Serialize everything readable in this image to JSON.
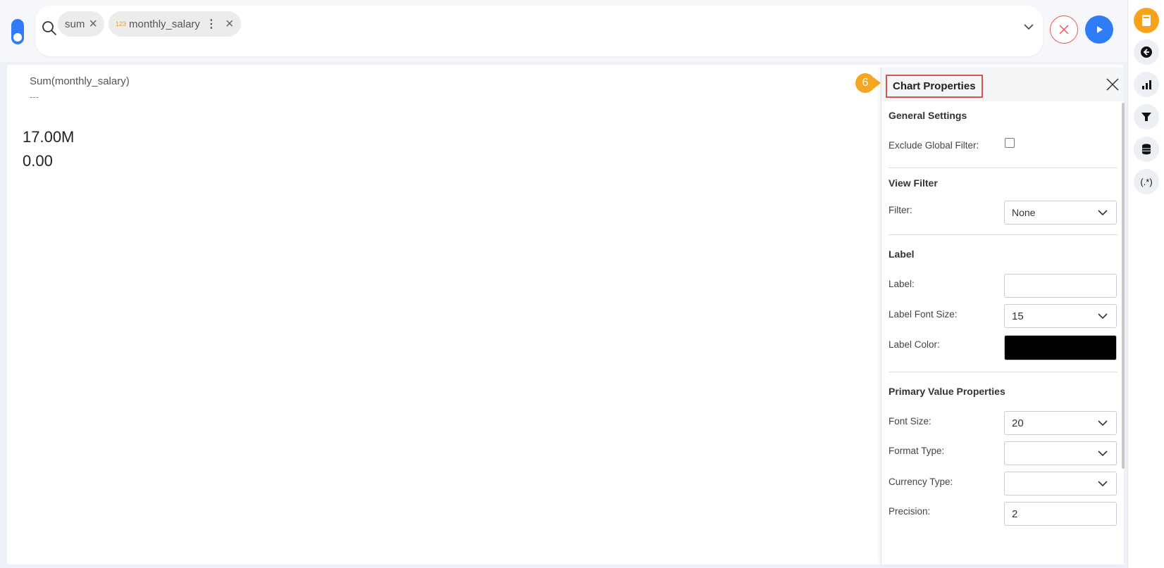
{
  "search": {
    "chips": [
      {
        "label": "sum"
      },
      {
        "type_badge": "123",
        "label": "monthly_salary"
      }
    ]
  },
  "metric": {
    "title": "Sum(monthly_salary)",
    "subtitle": "---",
    "value_max": "17.00M",
    "value_min": "0.00"
  },
  "step_badge": "6",
  "panel": {
    "title": "Chart Properties",
    "general_settings": {
      "heading": "General Settings",
      "exclude_global_filter_label": "Exclude Global Filter:",
      "exclude_global_filter_checked": false
    },
    "view_filter": {
      "heading": "View Filter",
      "filter_label": "Filter:",
      "filter_value": "None"
    },
    "label": {
      "heading": "Label",
      "label_label": "Label:",
      "label_value": "",
      "font_size_label": "Label Font Size:",
      "font_size_value": "15",
      "color_label": "Label Color:",
      "color_value": "#000000"
    },
    "primary_value": {
      "heading": "Primary Value Properties",
      "font_size_label": "Font Size:",
      "font_size_value": "20",
      "format_type_label": "Format Type:",
      "format_type_value": "",
      "currency_type_label": "Currency Type:",
      "currency_type_value": "",
      "precision_label": "Precision:",
      "precision_value": "2"
    }
  },
  "rail": [
    "notebook-icon",
    "back-arrow-icon",
    "bar-chart-icon",
    "filter-icon",
    "database-icon",
    "regex-icon"
  ],
  "rail_regex_text": "(.*)",
  "colors": {
    "accent": "#2f7cf6",
    "badge": "#f5a623",
    "danger": "#e55555"
  }
}
